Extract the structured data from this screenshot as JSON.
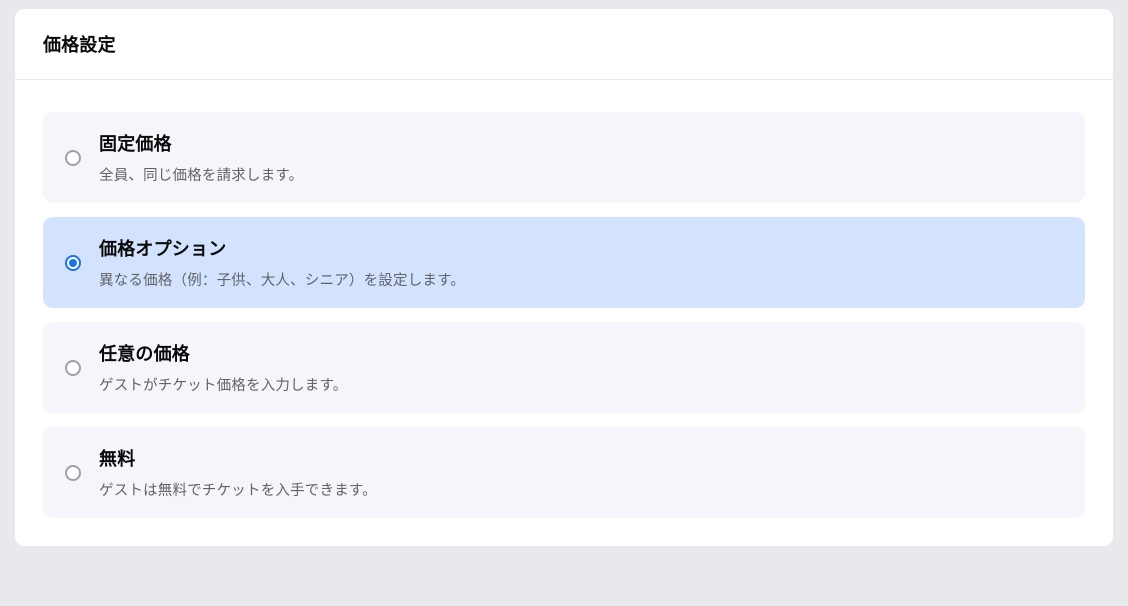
{
  "header": {
    "title": "価格設定"
  },
  "options": [
    {
      "id": "fixed",
      "title": "固定価格",
      "description": "全員、同じ価格を請求します。",
      "selected": false
    },
    {
      "id": "tiered",
      "title": "価格オプション",
      "description": "異なる価格（例：子供、大人、シニア）を設定します。",
      "selected": true
    },
    {
      "id": "suggested",
      "title": "任意の価格",
      "description": "ゲストがチケット価格を入力します。",
      "selected": false
    },
    {
      "id": "free",
      "title": "無料",
      "description": "ゲストは無料でチケットを入手できます。",
      "selected": false
    }
  ]
}
